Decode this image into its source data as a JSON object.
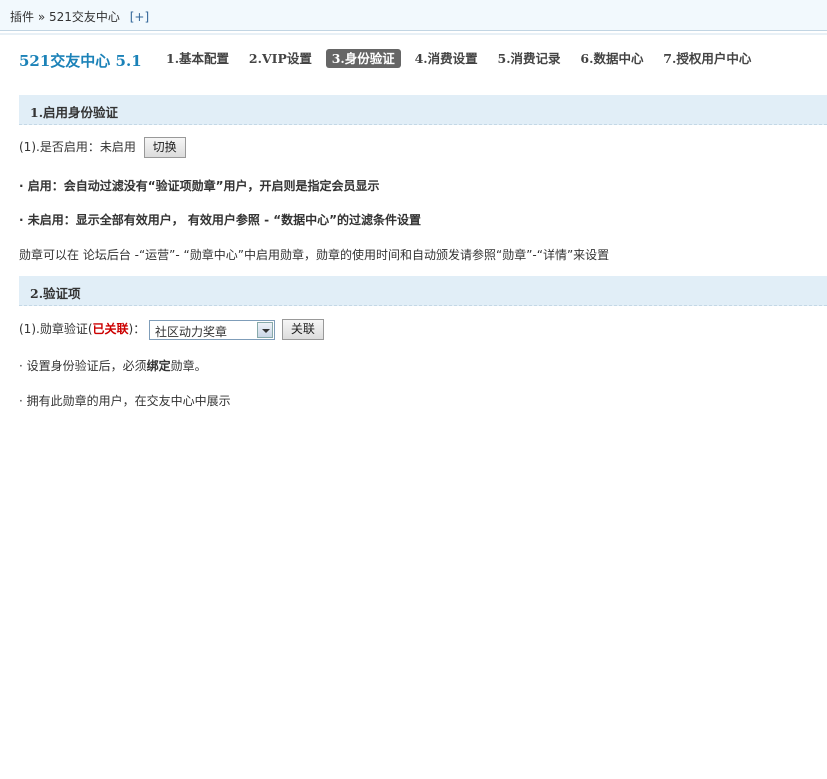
{
  "breadcrumb": {
    "plugins": "插件",
    "sep": "»",
    "current": "521交友中心",
    "add": "[+]"
  },
  "plugin": {
    "title": "521交友中心 5.1"
  },
  "nav": {
    "tabs": [
      {
        "label": "1.基本配置"
      },
      {
        "label": "2.VIP设置"
      },
      {
        "label": "3.身份验证",
        "active": true
      },
      {
        "label": "4.消费设置"
      },
      {
        "label": "5.消费记录"
      },
      {
        "label": "6.数据中心"
      },
      {
        "label": "7.授权用户中心"
      }
    ]
  },
  "section1": {
    "title": "1.启用身份验证",
    "enable_label": "(1).是否启用：",
    "enable_value": "未启用",
    "toggle_button": "切换",
    "note_enabled": "· 启用：会自动过滤没有“验证项勋章”用户，开启则是指定会员显示",
    "note_disabled": "· 未启用：显示全部有效用户， 有效用户参照 - “数据中心”的过滤条件设置",
    "note_medal": "勋章可以在 论坛后台 -“运营”- “勋章中心”中启用勋章，勋章的使用时间和自动颁发请参照“勋章”-“详情”来设置"
  },
  "section2": {
    "title": "2.验证项",
    "medal_label_prefix": "(1).勋章验证(",
    "medal_status": "已关联",
    "medal_label_suffix": ")：",
    "select_value": "社区动力奖章",
    "link_button": "关联",
    "note1_prefix": "· 设置身份验证后，必须",
    "note1_bold": "绑定",
    "note1_suffix": "勋章。",
    "note2": "· 拥有此勋章的用户，在交友中心中展示"
  }
}
